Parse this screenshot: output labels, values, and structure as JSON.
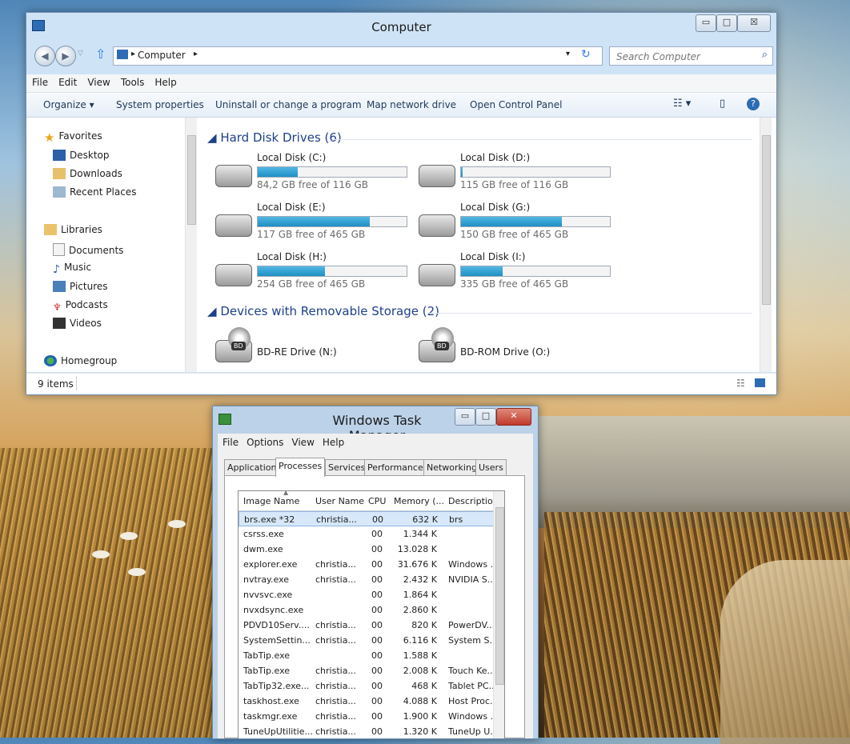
{
  "explorer": {
    "title": "Computer",
    "controls": {
      "minimize": "▭",
      "maximize": "□",
      "close": "☒"
    },
    "address": "Computer",
    "search_placeholder": "Search Computer",
    "menu": [
      "File",
      "Edit",
      "View",
      "Tools",
      "Help"
    ],
    "commands": [
      "Organize ▾",
      "System properties",
      "Uninstall or change a program",
      "Map network drive",
      "Open Control Panel"
    ],
    "nav": {
      "favorites": "Favorites",
      "desktop": "Desktop",
      "downloads": "Downloads",
      "recent": "Recent Places",
      "libraries": "Libraries",
      "documents": "Documents",
      "music": "Music",
      "pictures": "Pictures",
      "podcasts": "Podcasts",
      "videos": "Videos",
      "homegroup": "Homegroup"
    },
    "group_hdd": "Hard Disk Drives (6)",
    "group_removable": "Devices with Removable Storage (2)",
    "drives": [
      {
        "name": "Local Disk (C:)",
        "free": "84,2 GB free of 116 GB",
        "used_fraction": 0.27
      },
      {
        "name": "Local Disk (D:)",
        "free": "115 GB free of 116 GB",
        "used_fraction": 0.01
      },
      {
        "name": "Local Disk (E:)",
        "free": "117 GB free of 465 GB",
        "used_fraction": 0.75
      },
      {
        "name": "Local Disk (G:)",
        "free": "150 GB free of 465 GB",
        "used_fraction": 0.68
      },
      {
        "name": "Local Disk (H:)",
        "free": "254 GB free of 465 GB",
        "used_fraction": 0.45
      },
      {
        "name": "Local Disk (I:)",
        "free": "335 GB free of 465 GB",
        "used_fraction": 0.28
      }
    ],
    "removable": [
      {
        "name": "BD-RE Drive (N:)",
        "badge": "BD"
      },
      {
        "name": "BD-ROM Drive (O:)",
        "badge": "BD"
      }
    ],
    "status": "9 items"
  },
  "taskmgr": {
    "title": "Windows Task Manager",
    "controls": {
      "minimize": "▭",
      "maximize": "□",
      "close": "✕"
    },
    "menu": [
      "File",
      "Options",
      "View",
      "Help"
    ],
    "tabs": [
      "Applications",
      "Processes",
      "Services",
      "Performance",
      "Networking",
      "Users"
    ],
    "columns": [
      "Image Name",
      "User Name",
      "CPU",
      "Memory (...",
      "Description"
    ],
    "rows": [
      [
        "brs.exe *32",
        "christia...",
        "00",
        "632 K",
        "brs"
      ],
      [
        "csrss.exe",
        "",
        "00",
        "1.344 K",
        ""
      ],
      [
        "dwm.exe",
        "",
        "00",
        "13.028 K",
        ""
      ],
      [
        "explorer.exe",
        "christia...",
        "00",
        "31.676 K",
        "Windows ..."
      ],
      [
        "nvtray.exe",
        "christia...",
        "00",
        "2.432 K",
        "NVIDIA S..."
      ],
      [
        "nvvsvc.exe",
        "",
        "00",
        "1.864 K",
        ""
      ],
      [
        "nvxdsync.exe",
        "",
        "00",
        "2.860 K",
        ""
      ],
      [
        "PDVD10Serv....",
        "christia...",
        "00",
        "820 K",
        "PowerDV..."
      ],
      [
        "SystemSettin...",
        "christia...",
        "00",
        "6.116 K",
        "System S..."
      ],
      [
        "TabTip.exe",
        "",
        "00",
        "1.588 K",
        ""
      ],
      [
        "TabTip.exe",
        "christia...",
        "00",
        "2.008 K",
        "Touch Ke..."
      ],
      [
        "TabTip32.exe...",
        "christia...",
        "00",
        "468 K",
        "Tablet PC..."
      ],
      [
        "taskhost.exe",
        "christia...",
        "00",
        "4.088 K",
        "Host Proc..."
      ],
      [
        "taskmgr.exe",
        "christia...",
        "00",
        "1.900 K",
        "Windows ..."
      ],
      [
        "TuneUpUtilitie...",
        "christia...",
        "00",
        "1.320 K",
        "TuneUp U..."
      ]
    ]
  }
}
